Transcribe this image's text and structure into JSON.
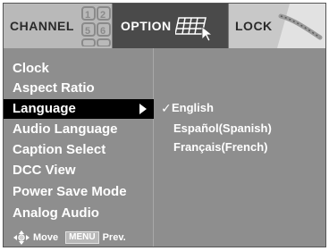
{
  "tabs": {
    "channel": "CHANNEL",
    "option": "OPTION",
    "lock": "LOCK"
  },
  "menu": {
    "items": [
      {
        "label": "Clock"
      },
      {
        "label": "Aspect Ratio"
      },
      {
        "label": "Language"
      },
      {
        "label": "Audio Language"
      },
      {
        "label": "Caption Select"
      },
      {
        "label": "DCC View"
      },
      {
        "label": "Power Save Mode"
      },
      {
        "label": "Analog Audio"
      }
    ],
    "selected_index": 2
  },
  "footer": {
    "move": "Move",
    "menu_key": "MENU",
    "prev": "Prev."
  },
  "language_options": {
    "items": [
      "English",
      "Español(Spanish)",
      "Français(French)"
    ],
    "checked_index": 0
  },
  "icons": {
    "channel_tab": "remote-keypad-icon",
    "option_tab": "keyboard-icon",
    "lock_tab": "lock-icon",
    "footer_nav": "navigation-pad-icon",
    "check": "check-icon",
    "arrow": "right-arrow-icon"
  },
  "colors": {
    "panel": "#8e8e8e",
    "selected": "#000000",
    "active_tab": "#4a4a4a",
    "text": "#ffffff"
  }
}
